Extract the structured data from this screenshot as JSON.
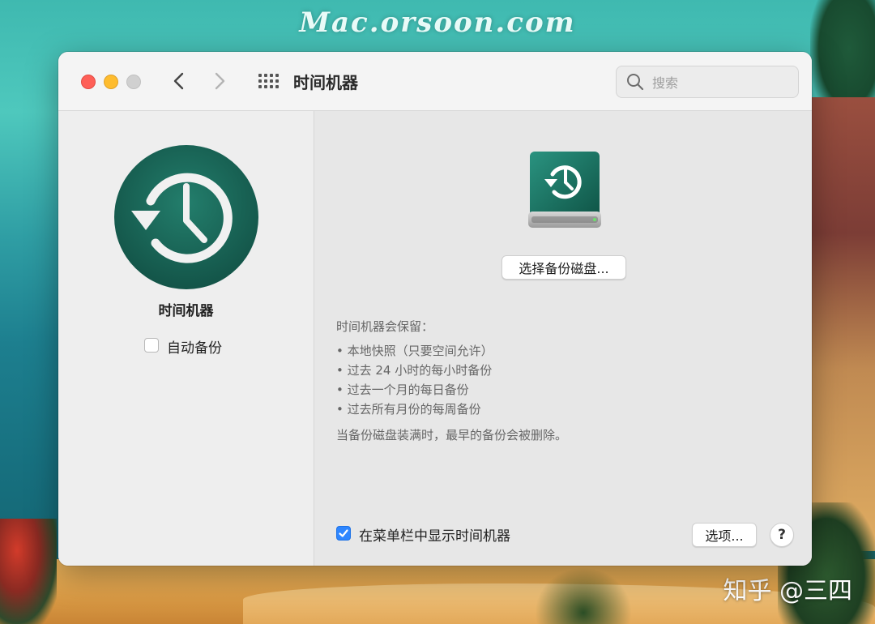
{
  "wallpaper": {
    "watermark_top": "Mac.orsoon.com",
    "watermark_bottom": "知乎 @三四"
  },
  "window": {
    "title": "时间机器",
    "search": {
      "placeholder": "搜索",
      "value": ""
    },
    "traffic_colors": {
      "close": "#fe5f57",
      "minimize": "#febc2e",
      "zoom": "#d0d0d0"
    }
  },
  "sidebar": {
    "icon": "time-machine-icon",
    "title": "时间机器",
    "auto_backup": {
      "label": "自动备份",
      "checked": false
    }
  },
  "main": {
    "disk_icon": "backup-disk-icon",
    "select_disk_label": "选择备份磁盘...",
    "info": {
      "heading": "时间机器会保留：",
      "items": [
        "• 本地快照（只要空间允许）",
        "• 过去 24 小时的每小时备份",
        "• 过去一个月的每日备份",
        "• 过去所有月份的每周备份"
      ],
      "footer": "当备份磁盘装满时，最早的备份会被删除。"
    },
    "show_in_menubar": {
      "label": "在菜单栏中显示时间机器",
      "checked": true
    },
    "options_label": "选项...",
    "help_label": "?"
  },
  "colors": {
    "accent": "#2e86ff",
    "time_machine_green": "#1a6b5c"
  }
}
